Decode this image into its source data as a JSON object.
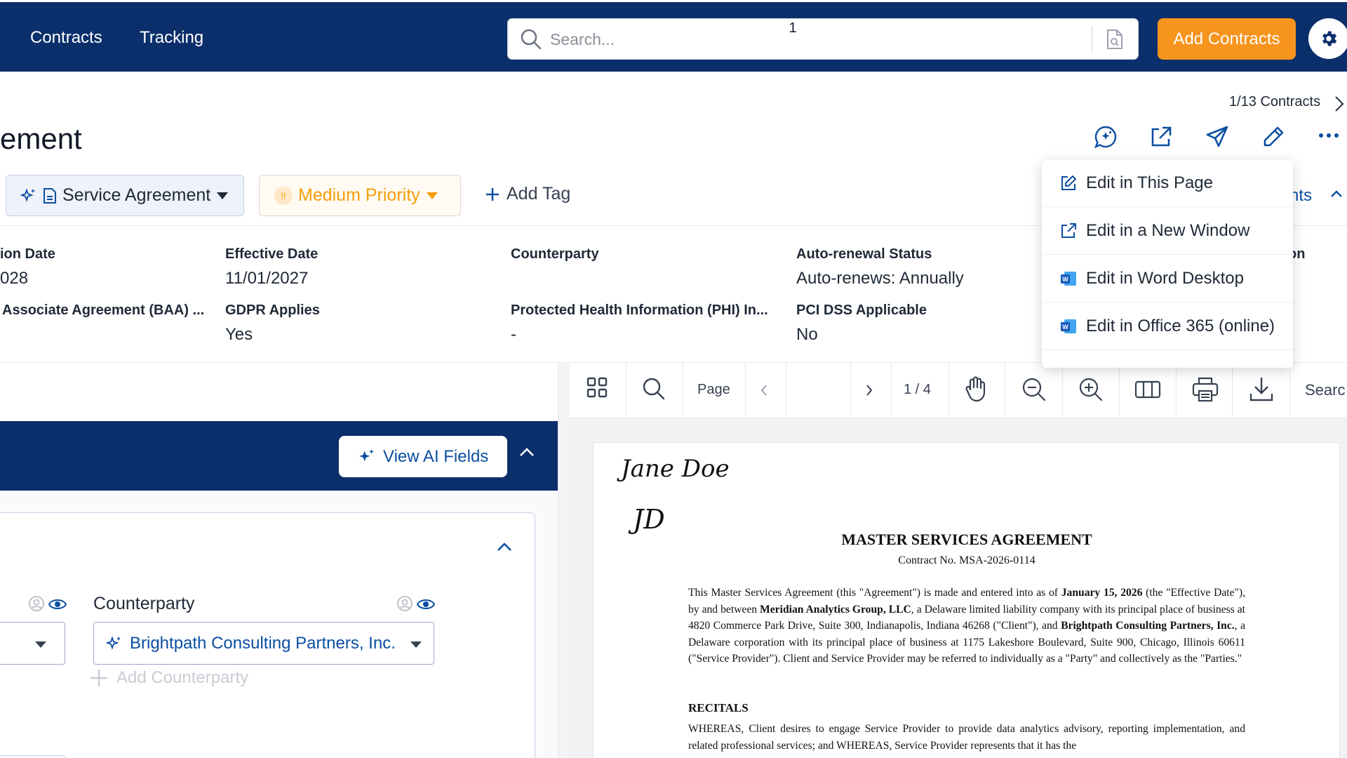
{
  "nav": {
    "contracts": "Contracts",
    "tracking": "Tracking",
    "search_placeholder": "Search...",
    "add_contracts": "Add Contracts"
  },
  "header": {
    "nav_count": "1/13 Contracts",
    "title": "ement",
    "contract_type": "Service Agreement",
    "priority": "Medium Priority",
    "priority_mark": "!!",
    "add_tag": "Add Tag"
  },
  "fields": [
    {
      "label": "ion Date",
      "value": "028"
    },
    {
      "label": "Effective Date",
      "value": "11/01/2027"
    },
    {
      "label": "Counterparty",
      "value": ""
    },
    {
      "label": "Auto-renewal Status",
      "value": "Auto-renews: Annually"
    },
    {
      "label": "Associate Agreement (BAA) ...",
      "value": ""
    },
    {
      "label": "GDPR Applies",
      "value": "Yes"
    },
    {
      "label": "Protected Health Information (PHI) In...",
      "value": "-"
    },
    {
      "label": "PCI DSS Applicable",
      "value": "No"
    }
  ],
  "partial_right_label": "on",
  "insights_partial": "hts",
  "menu": {
    "items": [
      "Edit in This Page",
      "Edit in a New Window",
      "Edit in Word Desktop",
      "Edit in Office 365 (online)"
    ]
  },
  "left_panel": {
    "view_ai_fields": "View AI Fields",
    "counterparty_label": "Counterparty",
    "counterparty_value": "Brightpath Consulting Partners, Inc.",
    "add_counterparty": "Add Counterparty"
  },
  "viewer": {
    "page_label": "Page",
    "page_value": "1",
    "page_total": "1 / 4",
    "search_partial": "Searc"
  },
  "document": {
    "signature_name": "Jane Doe",
    "signature_initials": "JD",
    "title": "MASTER SERVICES AGREEMENT",
    "contract_no": "Contract No. MSA-2026-0114",
    "para1": {
      "t1": "This Master Services Agreement (this \"Agreement\") is made and entered into as of ",
      "b1": "January 15, 2026",
      "t2": " (the \"Effective Date\"), by and between ",
      "b2": "Meridian Analytics Group, LLC",
      "t3": ", a Delaware limited liability company with its principal place of business at 4820 Commerce Park Drive, Suite 300, Indianapolis, Indiana 46268 (\"Client\"), and ",
      "b3": "Brightpath Consulting Partners, Inc.",
      "t4": ", a Delaware corporation with its principal place of business at 1175 Lakeshore Boulevard, Suite 900, Chicago, Illinois 60611 (\"Service Provider\"). Client and Service Provider may be referred to individually as a \"Party\" and collectively as the \"Parties.\""
    },
    "recitals_heading": "RECITALS",
    "recitals_text": "WHEREAS, Client desires to engage Service Provider to provide data analytics advisory, reporting implementation, and related professional services; and WHEREAS, Service Provider represents that it has the"
  },
  "colors": {
    "nav_bg": "#0b2f6b",
    "accent_orange": "#f7941d",
    "link_blue": "#0b4ea2"
  }
}
